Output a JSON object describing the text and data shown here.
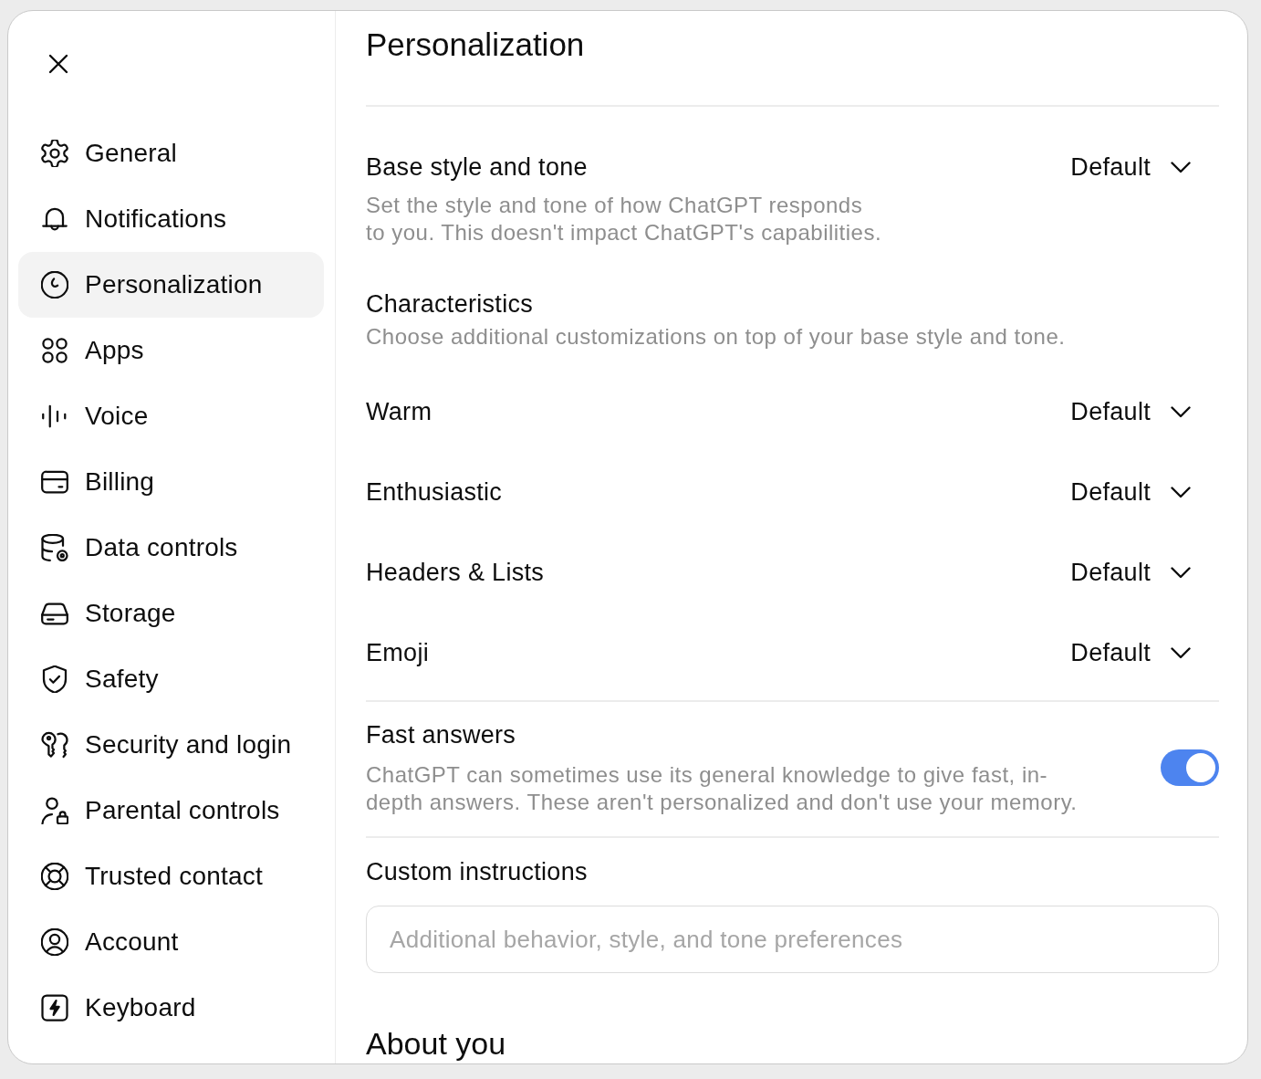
{
  "sidebar": {
    "items": [
      {
        "label": "General",
        "selected": false
      },
      {
        "label": "Notifications",
        "selected": false
      },
      {
        "label": "Personalization",
        "selected": true
      },
      {
        "label": "Apps",
        "selected": false
      },
      {
        "label": "Voice",
        "selected": false
      },
      {
        "label": "Billing",
        "selected": false
      },
      {
        "label": "Data controls",
        "selected": false
      },
      {
        "label": "Storage",
        "selected": false
      },
      {
        "label": "Safety",
        "selected": false
      },
      {
        "label": "Security and login",
        "selected": false
      },
      {
        "label": "Parental controls",
        "selected": false
      },
      {
        "label": "Trusted contact",
        "selected": false
      },
      {
        "label": "Account",
        "selected": false
      },
      {
        "label": "Keyboard",
        "selected": false
      }
    ]
  },
  "content": {
    "title": "Personalization",
    "base_style": {
      "label": "Base style and tone",
      "description": "Set the style and tone of how ChatGPT responds to you. This doesn't impact ChatGPT's capabilities.",
      "value": "Default"
    },
    "characteristics": {
      "title": "Characteristics",
      "description": "Choose additional customizations on top of your base style and tone.",
      "items": [
        {
          "label": "Warm",
          "value": "Default"
        },
        {
          "label": "Enthusiastic",
          "value": "Default"
        },
        {
          "label": "Headers & Lists",
          "value": "Default"
        },
        {
          "label": "Emoji",
          "value": "Default"
        }
      ]
    },
    "fast_answers": {
      "label": "Fast answers",
      "description": "ChatGPT can sometimes use its general knowledge to give fast, in-depth answers. These aren't personalized and don't use your memory.",
      "on": true
    },
    "custom_instructions": {
      "label": "Custom instructions",
      "placeholder": "Additional behavior, style, and tone preferences"
    },
    "about_you": {
      "title": "About you"
    }
  }
}
